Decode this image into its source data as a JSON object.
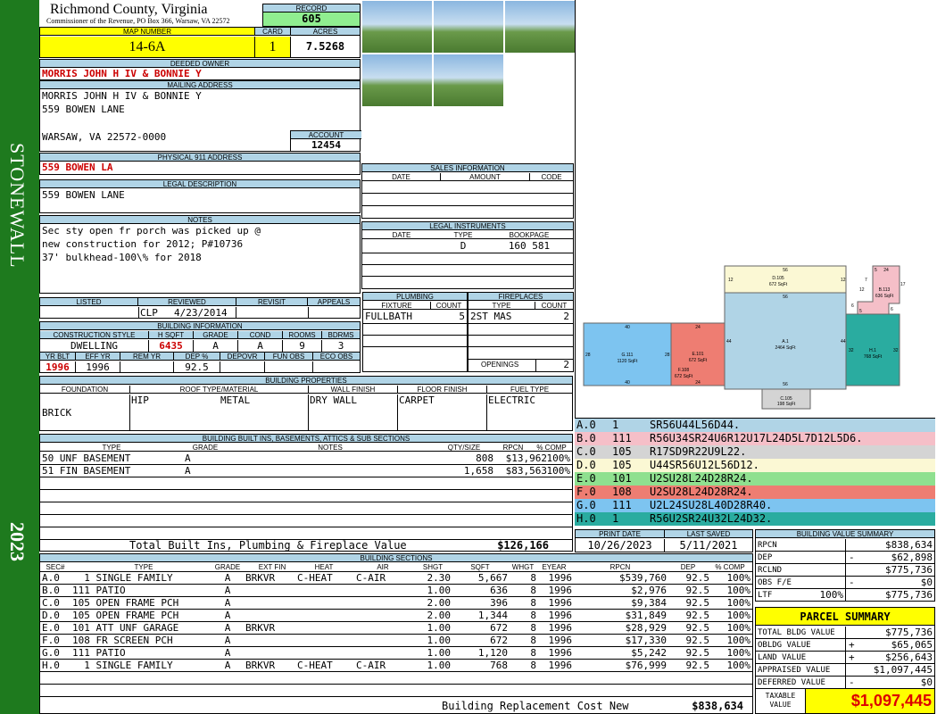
{
  "sidebar": {
    "district": "STONEWALL",
    "year": "2023"
  },
  "header": {
    "county": "Richmond County, Virginia",
    "commissioner": "Commissioner of the Revenue, PO Box 366, Warsaw, VA 22572",
    "record_label": "RECORD",
    "record": "605",
    "map_label": "MAP NUMBER",
    "map": "14-6A",
    "card_label": "CARD",
    "card": "1",
    "acres_label": "ACRES",
    "acres": "7.5268"
  },
  "owner": {
    "label": "DEEDED OWNER",
    "name": "MORRIS JOHN H IV & BONNIE Y",
    "mail_label": "MAILING ADDRESS",
    "mail1": "MORRIS JOHN H IV & BONNIE Y",
    "mail2": "559 BOWEN LANE",
    "mail3": "WARSAW, VA 22572-0000",
    "account_label": "ACCOUNT",
    "account": "12454",
    "phys_label": "PHYSICAL 911 ADDRESS",
    "phys": "559 BOWEN LA",
    "legal_label": "LEGAL DESCRIPTION",
    "legal": "559 BOWEN LANE"
  },
  "notes": {
    "label": "NOTES",
    "l1": "Sec sty open fr porch was picked up @",
    "l2": "new construction for 2012; P#10736",
    "l3": "37' bulkhead-100\\% for 2018"
  },
  "listing": {
    "h_listed": "LISTED",
    "h_reviewed": "REVIEWED",
    "h_revisit": "REVISIT",
    "h_appeals": "APPEALS",
    "reviewed_by": "CLP",
    "reviewed": "4/23/2014"
  },
  "bldg_info": {
    "label": "BUILDING INFORMATION",
    "h_style": "CONSTRUCTION STYLE",
    "h_hsqft": "H SQFT",
    "h_grade": "GRADE",
    "h_cond": "COND",
    "h_rooms": "ROOMS",
    "h_bdrms": "BDRMS",
    "style": "DWELLING",
    "hsqft": "6435",
    "grade": "A",
    "cond": "A",
    "rooms": "9",
    "bdrms": "3",
    "h_yrblt": "YR BLT",
    "h_effyr": "EFF YR",
    "h_remyr": "REM YR",
    "h_dep": "DEP %",
    "h_depovr": "DEPOVR",
    "h_funobs": "FUN OBS",
    "h_ecoobs": "ECO OBS",
    "yrblt": "1996",
    "effyr": "1996",
    "dep": "92.5"
  },
  "sales": {
    "label": "SALES INFORMATION",
    "h_date": "DATE",
    "h_amount": "AMOUNT",
    "h_code": "CODE"
  },
  "legal_instr": {
    "label": "LEGAL INSTRUMENTS",
    "h_date": "DATE",
    "h_type": "TYPE",
    "h_book": "BOOKPAGE",
    "type": "D",
    "book": "160 581"
  },
  "plumbing": {
    "label": "PLUMBING",
    "h_fixture": "FIXTURE",
    "h_count": "COUNT",
    "fixture": "FULLBATH",
    "count": "5"
  },
  "fireplaces": {
    "label": "FIREPLACES",
    "h_type": "TYPE",
    "h_count": "COUNT",
    "type": "2ST MAS",
    "count": "2",
    "openings_label": "OPENINGS",
    "openings": "2"
  },
  "props": {
    "label": "BUILDING PROPERTIES",
    "h_found": "FOUNDATION",
    "h_roof": "ROOF TYPE/MATERIAL",
    "h_wall": "WALL FINISH",
    "h_floor": "FLOOR FINISH",
    "h_fuel": "FUEL TYPE",
    "found": "BRICK",
    "roof_type": "HIP",
    "roof_mat": "METAL",
    "wall": "DRY WALL",
    "floor": "CARPET",
    "fuel": "ELECTRIC"
  },
  "builtins": {
    "label": "BUILDING BUILT INS, BASEMENTS, ATTICS & SUB SECTIONS",
    "h_type": "TYPE",
    "h_grade": "GRADE",
    "h_notes": "NOTES",
    "h_qty": "QTY/SIZE",
    "h_rpcn": "RPCN",
    "h_comp": "% COMP",
    "rows": [
      {
        "type": "50 UNF BASEMENT",
        "grade": "A",
        "qty": "808",
        "rpcn": "$13,962",
        "comp": "100%"
      },
      {
        "type": "51 FIN BASEMENT",
        "grade": "A",
        "qty": "1,658",
        "rpcn": "$83,563",
        "comp": "100%"
      }
    ],
    "total_label": "Total Built Ins, Plumbing & Fireplace Value",
    "total": "$126,166"
  },
  "sections": {
    "label": "BUILDING SECTIONS",
    "h_sec": "SEC#",
    "h_type": "TYPE",
    "h_grade": "GRADE",
    "h_extfin": "EXT FIN",
    "h_heat": "HEAT",
    "h_air": "AIR",
    "h_shgt": "SHGT",
    "h_sqft": "SQFT",
    "h_whgt": "WHGT",
    "h_eyear": "EYEAR",
    "h_rpcn": "RPCN",
    "h_dep": "DEP",
    "h_comp": "% COMP",
    "rows": [
      {
        "sec": "A.0",
        "type": "  1 SINGLE FAMILY",
        "grade": "A",
        "extfin": "BRKVR",
        "heat": "C-HEAT",
        "air": "C-AIR",
        "shgt": "2.30",
        "sqft": "5,667",
        "whgt": "8",
        "eyear": "1996",
        "rpcn": "$539,760",
        "dep": "92.5",
        "comp": "100%"
      },
      {
        "sec": "B.0",
        "type": "111 PATIO",
        "grade": "A",
        "extfin": "",
        "heat": "",
        "air": "",
        "shgt": "1.00",
        "sqft": "636",
        "whgt": "8",
        "eyear": "1996",
        "rpcn": "$2,976",
        "dep": "92.5",
        "comp": "100%"
      },
      {
        "sec": "C.0",
        "type": "105 OPEN FRAME PCH",
        "grade": "A",
        "extfin": "",
        "heat": "",
        "air": "",
        "shgt": "2.00",
        "sqft": "396",
        "whgt": "8",
        "eyear": "1996",
        "rpcn": "$9,384",
        "dep": "92.5",
        "comp": "100%"
      },
      {
        "sec": "D.0",
        "type": "105 OPEN FRAME PCH",
        "grade": "A",
        "extfin": "",
        "heat": "",
        "air": "",
        "shgt": "2.00",
        "sqft": "1,344",
        "whgt": "8",
        "eyear": "1996",
        "rpcn": "$31,849",
        "dep": "92.5",
        "comp": "100%"
      },
      {
        "sec": "E.0",
        "type": "101 ATT UNF GARAGE",
        "grade": "A",
        "extfin": "BRKVR",
        "heat": "",
        "air": "",
        "shgt": "1.00",
        "sqft": "672",
        "whgt": "8",
        "eyear": "1996",
        "rpcn": "$28,929",
        "dep": "92.5",
        "comp": "100%"
      },
      {
        "sec": "F.0",
        "type": "108 FR SCREEN PCH",
        "grade": "A",
        "extfin": "",
        "heat": "",
        "air": "",
        "shgt": "1.00",
        "sqft": "672",
        "whgt": "8",
        "eyear": "1996",
        "rpcn": "$17,330",
        "dep": "92.5",
        "comp": "100%"
      },
      {
        "sec": "G.0",
        "type": "111 PATIO",
        "grade": "A",
        "extfin": "",
        "heat": "",
        "air": "",
        "shgt": "1.00",
        "sqft": "1,120",
        "whgt": "8",
        "eyear": "1996",
        "rpcn": "$5,242",
        "dep": "92.5",
        "comp": "100%"
      },
      {
        "sec": "H.0",
        "type": "  1 SINGLE FAMILY",
        "grade": "A",
        "extfin": "BRKVR",
        "heat": "C-HEAT",
        "air": "C-AIR",
        "shgt": "1.00",
        "sqft": "768",
        "whgt": "8",
        "eyear": "1996",
        "rpcn": "$76,999",
        "dep": "92.5",
        "comp": "100%"
      }
    ],
    "brcn_label": "Building Replacement Cost New",
    "brcn": "$838,634"
  },
  "sketch_legend": [
    {
      "sec": "A.0",
      "code": "1",
      "desc": "SR56U44L56D44.",
      "color": "#b0d4e6"
    },
    {
      "sec": "B.0",
      "code": "111",
      "desc": "R56U34SR24U6R12U17L24D5L7D12L5D6.",
      "color": "#f5bfc8"
    },
    {
      "sec": "C.0",
      "code": "105",
      "desc": "R17SD9R22U9L22.",
      "color": "#d4d4d4"
    },
    {
      "sec": "D.0",
      "code": "105",
      "desc": "U44SR56U12L56D12.",
      "color": "#fbf8d4"
    },
    {
      "sec": "E.0",
      "code": "101",
      "desc": "U2SU28L24D28R24.",
      "color": "#8fe08f"
    },
    {
      "sec": "F.0",
      "code": "108",
      "desc": "U2SU28L24D28R24.",
      "color": "#ee7d72"
    },
    {
      "sec": "G.0",
      "code": "111",
      "desc": "U2L24SU28L40D28R40.",
      "color": "#7dc4f0"
    },
    {
      "sec": "H.0",
      "code": "1",
      "desc": "R56U2SR24U32L24D32.",
      "color": "#2aaca0"
    }
  ],
  "sketch": {
    "A": {
      "id": "A.1",
      "sqft": "2464 SqFt",
      "t": "56",
      "b": "56",
      "l": "44",
      "r": "44"
    },
    "D": {
      "id": "D.105",
      "sqft": "672 SqFt",
      "t": "56",
      "l": "12",
      "r": "12"
    },
    "C": {
      "id": "C.105",
      "sqft": "198 SqFt"
    },
    "G": {
      "id": "G.111",
      "sqft": "1120 SqFt",
      "t": "40",
      "b": "40",
      "l": "28",
      "r": "28"
    },
    "E": {
      "id": "E.101",
      "sqft": "672 SqFt",
      "t": "24",
      "b": "24"
    },
    "F": {
      "id": "F.108",
      "sqft": "672 SqFt"
    },
    "H": {
      "id": "H.1",
      "sqft": "768 SqFt",
      "l": "32",
      "r": "32"
    },
    "B": {
      "id": "B.113",
      "sqft": "636 SqFt",
      "n1": "24",
      "n2": "17",
      "n3": "12",
      "n4": "7",
      "n5": "5",
      "n6": "6",
      "n7": "6",
      "n8": "5"
    }
  },
  "print": {
    "h_print": "PRINT DATE",
    "h_saved": "LAST SAVED",
    "print": "10/26/2023",
    "saved": "5/11/2021"
  },
  "bvs": {
    "label": "BUILDING VALUE SUMMARY",
    "rows": [
      {
        "k": "RPCN",
        "op": "",
        "v": "$838,634"
      },
      {
        "k": "DEP",
        "op": "-",
        "v": "$62,898"
      },
      {
        "k": "RCLND",
        "op": "",
        "v": "$775,736"
      },
      {
        "k": "OBS F/E",
        "op": "-",
        "v": "$0"
      },
      {
        "k": "LTF",
        "pct": "100%",
        "op": "",
        "v": "$775,736"
      }
    ]
  },
  "parcel": {
    "label": "PARCEL SUMMARY",
    "rows": [
      {
        "k": "TOTAL BLDG VALUE",
        "op": "",
        "v": "$775,736"
      },
      {
        "k": "OBLDG VALUE",
        "op": "+",
        "v": "$65,065"
      },
      {
        "k": "LAND VALUE",
        "op": "+",
        "v": "$256,643"
      },
      {
        "k": "APPRAISED VALUE",
        "op": "",
        "v": "$1,097,445"
      },
      {
        "k": "DEFERRED VALUE",
        "op": "-",
        "v": "$0"
      }
    ],
    "taxable_label1": "TAXABLE",
    "taxable_label2": "VALUE",
    "taxable": "$1,097,445"
  }
}
